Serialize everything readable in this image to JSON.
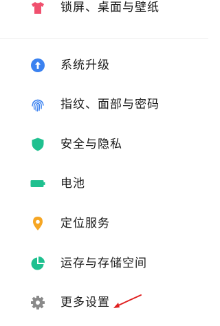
{
  "settings": {
    "items": [
      {
        "label": "锁屏、桌面与壁纸",
        "icon": "tshirt-icon",
        "color": "#f0506e"
      },
      {
        "label": "系统升级",
        "icon": "upgrade-arrow-icon",
        "color": "#3b82f0"
      },
      {
        "label": "指纹、面部与密码",
        "icon": "fingerprint-icon",
        "color": "#3b82f0"
      },
      {
        "label": "安全与隐私",
        "icon": "shield-icon",
        "color": "#1fc08f"
      },
      {
        "label": "电池",
        "icon": "battery-icon",
        "color": "#1fc08f"
      },
      {
        "label": "定位服务",
        "icon": "location-pin-icon",
        "color": "#f6a623"
      },
      {
        "label": "运存与存储空间",
        "icon": "storage-pie-icon",
        "color": "#1fc08f"
      },
      {
        "label": "更多设置",
        "icon": "gear-icon",
        "color": "#8a8a8a"
      }
    ]
  },
  "annotation": {
    "color": "#e02020"
  }
}
